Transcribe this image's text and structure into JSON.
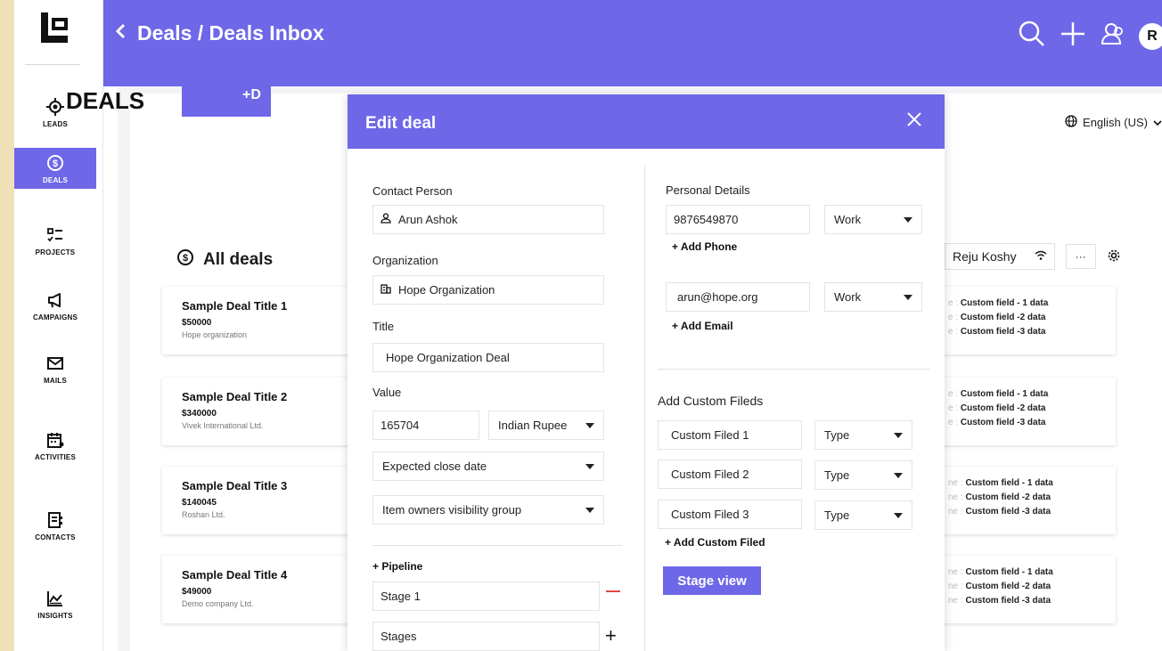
{
  "header": {
    "breadcrumb": "Deals / Deals Inbox",
    "avatar_initial": "R"
  },
  "sidebar": {
    "items": [
      {
        "label": "LEADS",
        "icon": "crosshair-icon"
      },
      {
        "label": "DEALS",
        "icon": "dollar-circle-icon",
        "active": true
      },
      {
        "label": "PROJECTS",
        "icon": "checklist-icon"
      },
      {
        "label": "CAMPAIGNS",
        "icon": "megaphone-icon"
      },
      {
        "label": "MAILS",
        "icon": "mail-icon"
      },
      {
        "label": "ACTIVITIES",
        "icon": "calendar-icon"
      },
      {
        "label": "CONTACTS",
        "icon": "contact-card-icon"
      },
      {
        "label": "INSIGHTS",
        "icon": "chart-icon"
      }
    ]
  },
  "page": {
    "title": "DEALS",
    "add_button": "+D",
    "all_deals": "All deals",
    "language": "English (US)",
    "owner": "Reju Koshy",
    "more": "···"
  },
  "deals": [
    {
      "title": "Sample Deal Title 1",
      "value": "$50000",
      "org": "Hope organization"
    },
    {
      "title": "Sample Deal Title 2",
      "value": "$340000",
      "org": "Vivek International Ltd."
    },
    {
      "title": "Sample Deal Title 3",
      "value": "$140045",
      "org": "Roshan Ltd."
    },
    {
      "title": "Sample Deal Title 4",
      "value": "$49000",
      "org": "Demo company Ltd."
    }
  ],
  "custom_rows": [
    {
      "prefix1": "e :",
      "prefix2": "e :",
      "prefix3": "e :",
      "r1": "Custom field - 1 data",
      "r2": "Custom field -2 data",
      "r3": "Custom field -3 data"
    },
    {
      "prefix1": "e :",
      "prefix2": "e :",
      "prefix3": "e :",
      "r1": "Custom field - 1 data",
      "r2": "Custom field -2 data",
      "r3": "Custom field -3 data"
    },
    {
      "prefix1": "ne :",
      "prefix2": "ne :",
      "prefix3": "ne :",
      "r1": "Custom field - 1 data",
      "r2": "Custom field -2 data",
      "r3": "Custom field -3 data"
    },
    {
      "prefix1": "ne :",
      "prefix2": "ne :",
      "prefix3": "ne :",
      "r1": "Custom field - 1 data",
      "r2": "Custom field -2 data",
      "r3": "Custom field -3 data"
    }
  ],
  "modal": {
    "title": "Edit deal",
    "contact_person_label": "Contact Person",
    "contact_person": "Arun Ashok",
    "organization_label": "Organization",
    "organization": "Hope Organization",
    "title_label": "Title",
    "title_value": "Hope Organization Deal",
    "value_label": "Value",
    "value": "165704",
    "currency": "Indian Rupee",
    "expected_close": "Expected close date",
    "visibility": "Item owners visibility group",
    "pipeline": "+ Pipeline",
    "stage1": "Stage 1",
    "stages": "Stages",
    "personal_label": "Personal Details",
    "phone": "9876549870",
    "phone_type": "Work",
    "add_phone": "+ Add Phone",
    "email": "arun@hope.org",
    "email_type": "Work",
    "add_email": "+ Add Email",
    "custom_label": "Add Custom Fileds",
    "custom_fields": [
      {
        "name": "Custom Filed 1",
        "type": "Type"
      },
      {
        "name": "Custom Filed 2",
        "type": "Type"
      },
      {
        "name": "Custom Filed 3",
        "type": "Type"
      }
    ],
    "add_custom": "+ Add Custom Filed",
    "stage_view": "Stage view"
  },
  "colors": {
    "accent": "#6e67e8",
    "danger": "#e04848"
  }
}
